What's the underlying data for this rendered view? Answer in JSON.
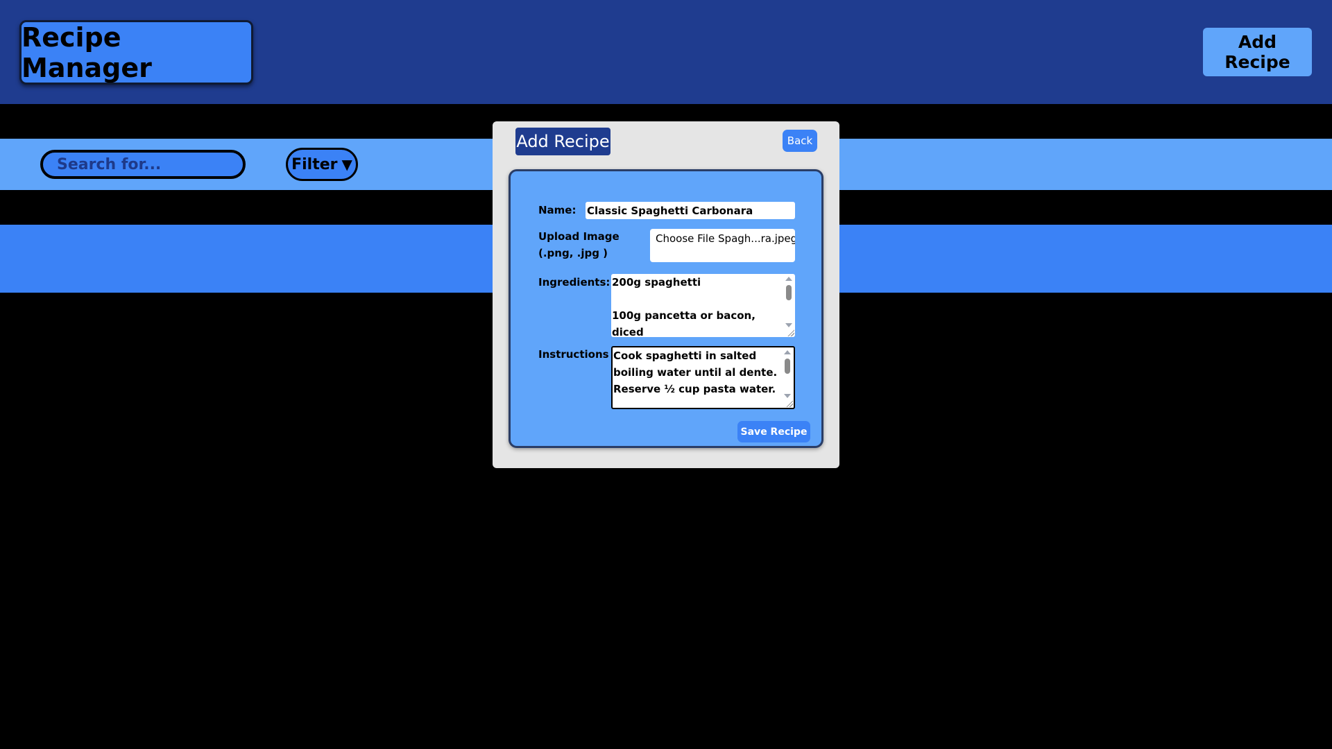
{
  "header": {
    "title": "Recipe Manager",
    "add_button": "Add Recipe"
  },
  "search": {
    "placeholder": "Search for...",
    "filter_label": "Filter",
    "filter_icon": "triangle-down-icon"
  },
  "modal": {
    "title": "Add Recipe",
    "back_label": "Back",
    "form": {
      "name_label": "Name:",
      "name_value": "Classic Spaghetti Carbonara",
      "upload_label": "Upload Image (.png, .jpg )",
      "file_button": "Choose File",
      "file_name": "Spagh...ra.jpeg",
      "ingredients_label": "Ingredients:",
      "ingredients_lines": [
        "200g spaghetti",
        "",
        "100g pancetta or bacon, diced"
      ],
      "instructions_label": "Instructions",
      "instructions_text": "Cook spaghetti in salted boiling water until al dente. Reserve ½ cup pasta water.",
      "save_label": "Save Recipe"
    }
  },
  "colors": {
    "header_bg": "#1f3c8f",
    "accent": "#3b82f6",
    "light_accent": "#60a5fa",
    "modal_bg": "#e5e5e5"
  }
}
